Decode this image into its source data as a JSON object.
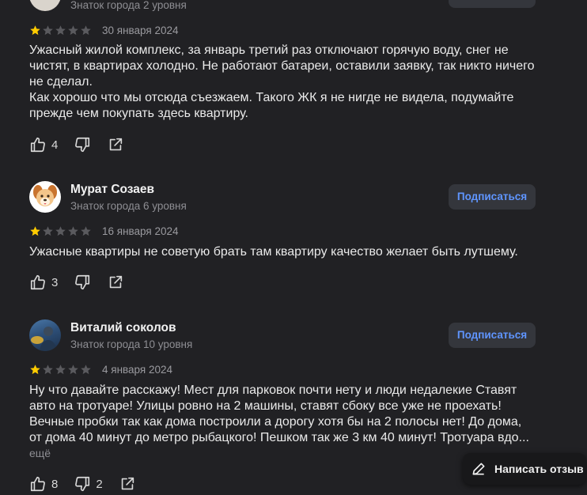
{
  "reviews": [
    {
      "author": "",
      "level": "Знаток города 2 уровня",
      "rating": 1,
      "date": "30 января 2024",
      "paragraphs": [
        "Ужасный жилой комплекс, за январь третий раз отключают горячую воду, снег не чистят, в квартирах холодно. Не работают батареи, оставили заявку, так никто ничего не сделал.",
        "Как хорошо что мы отсюда съезжаем. Такого ЖК я не нигде не видела, подумайте прежде чем покупать здесь квартиру."
      ],
      "likes": "4",
      "dislikes": ""
    },
    {
      "author": "Мурат Созаев",
      "level": "Знаток города 6 уровня",
      "subscribe": "Подписаться",
      "rating": 1,
      "date": "16 января 2024",
      "paragraphs": [
        "Ужасные квартиры не советую брать там квартиру качество желает быть лутшему."
      ],
      "likes": "3",
      "dislikes": ""
    },
    {
      "author": "Виталий соколов",
      "level": "Знаток города 10 уровня",
      "subscribe": "Подписаться",
      "rating": 1,
      "date": "4 января 2024",
      "paragraphs": [
        "Ну что давайте расскажу! Мест для парковок почти нету и люди недалекие Ставят авто на тротуаре! Улицы ровно на 2 машины, ставят сбоку все уже не проехать! Вечные пробки так как дома построили а дорогу хотя бы на 2 полосы нет! До дома, от дома 40 минут до метро рыбацкого! Пешком так же 3 км 40 минут! Тротуара вдо..."
      ],
      "more": "ещё",
      "likes": "8",
      "dislikes": "2"
    }
  ],
  "write_review": "Написать отзыв",
  "colors": {
    "star_filled": "#fc0",
    "star_empty": "#5a5a5e",
    "accent": "#5f95ff"
  },
  "icons": [
    "thumbs-up-icon",
    "thumbs-down-icon",
    "share-icon",
    "pencil-icon",
    "dog-avatar",
    "photo-avatar"
  ]
}
